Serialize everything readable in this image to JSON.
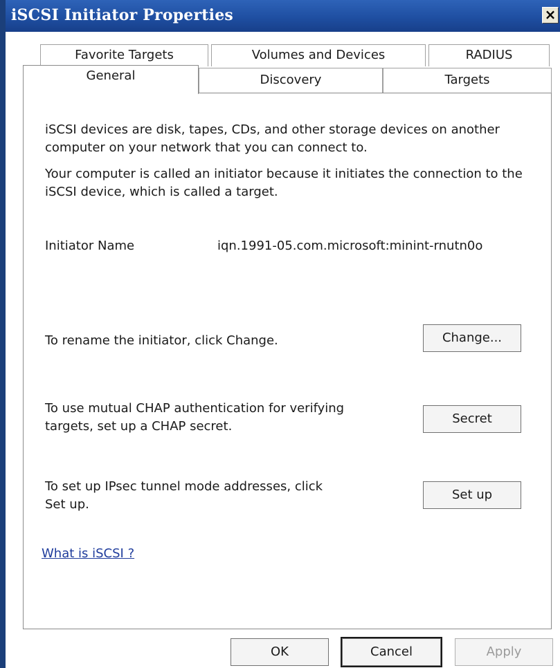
{
  "window": {
    "title": "iSCSI Initiator Properties",
    "close_glyph": "×"
  },
  "tabs": {
    "row1": [
      "Favorite Targets",
      "Volumes and Devices",
      "RADIUS"
    ],
    "row2": [
      "General",
      "Discovery",
      "Targets"
    ],
    "selected": "General"
  },
  "general": {
    "intro_1": "iSCSI devices are disk, tapes, CDs, and other storage devices on another computer on your network that you can connect to.",
    "intro_2": "Your computer is called an initiator because it initiates the connection to the iSCSI device, which is called a target.",
    "initiator_name_label": "Initiator Name",
    "initiator_name_value": "iqn.1991-05.com.microsoft:minint-rnutn0o",
    "rename_text": "To rename the initiator, click Change.",
    "change_button": "Change...",
    "chap_text": "To use mutual CHAP authentication for verifying targets, set up a CHAP secret.",
    "secret_button": "Secret",
    "ipsec_text": "To set up IPsec tunnel mode addresses, click Set up.",
    "setup_button": "Set up",
    "help_link": "What is iSCSI ?"
  },
  "footer": {
    "ok": "OK",
    "cancel": "Cancel",
    "apply": "Apply"
  },
  "colors": {
    "titlebar": "#1f4fa2",
    "link": "#1f3c9c",
    "disabled_text": "#9a9a9a"
  }
}
